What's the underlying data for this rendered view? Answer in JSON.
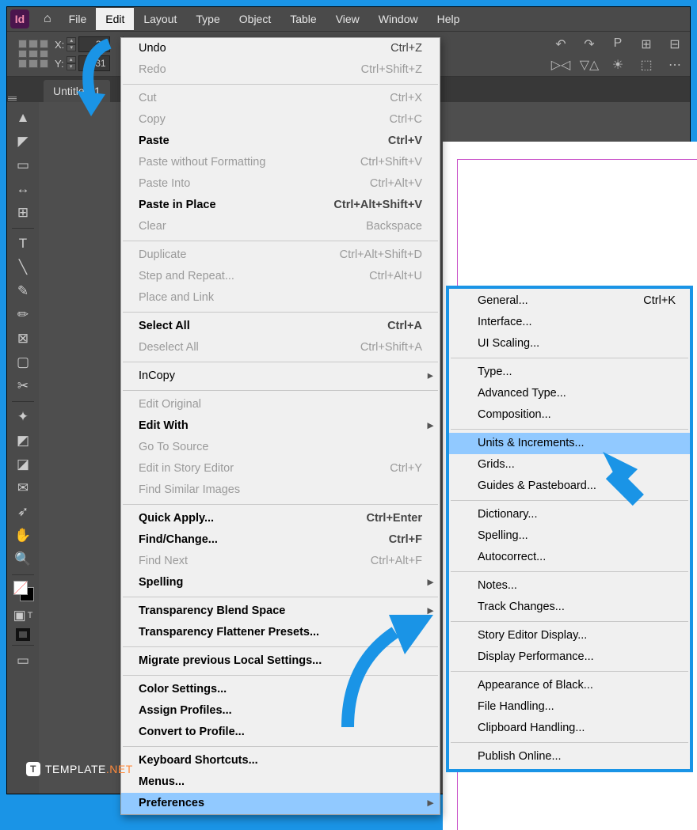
{
  "menubar": {
    "items": [
      "File",
      "Edit",
      "Layout",
      "Type",
      "Object",
      "Table",
      "View",
      "Window",
      "Help"
    ],
    "active": "Edit"
  },
  "control": {
    "x_val": "34",
    "y_val": "31"
  },
  "doc_tab": "Untitled-1",
  "edit_menu": [
    {
      "label": "Undo",
      "short": "Ctrl+Z"
    },
    {
      "label": "Redo",
      "short": "Ctrl+Shift+Z",
      "disabled": true
    },
    {
      "sep": true
    },
    {
      "label": "Cut",
      "short": "Ctrl+X",
      "disabled": true
    },
    {
      "label": "Copy",
      "short": "Ctrl+C",
      "disabled": true
    },
    {
      "label": "Paste",
      "short": "Ctrl+V",
      "bold": true
    },
    {
      "label": "Paste without Formatting",
      "short": "Ctrl+Shift+V",
      "disabled": true
    },
    {
      "label": "Paste Into",
      "short": "Ctrl+Alt+V",
      "disabled": true
    },
    {
      "label": "Paste in Place",
      "short": "Ctrl+Alt+Shift+V",
      "bold": true
    },
    {
      "label": "Clear",
      "short": "Backspace",
      "disabled": true
    },
    {
      "sep": true
    },
    {
      "label": "Duplicate",
      "short": "Ctrl+Alt+Shift+D",
      "disabled": true
    },
    {
      "label": "Step and Repeat...",
      "short": "Ctrl+Alt+U",
      "disabled": true
    },
    {
      "label": "Place and Link",
      "disabled": true
    },
    {
      "sep": true
    },
    {
      "label": "Select All",
      "short": "Ctrl+A",
      "bold": true
    },
    {
      "label": "Deselect All",
      "short": "Ctrl+Shift+A",
      "disabled": true
    },
    {
      "sep": true
    },
    {
      "label": "InCopy",
      "submenu": true
    },
    {
      "sep": true
    },
    {
      "label": "Edit Original",
      "disabled": true
    },
    {
      "label": "Edit With",
      "submenu": true,
      "bold": true
    },
    {
      "label": "Go To Source",
      "disabled": true
    },
    {
      "label": "Edit in Story Editor",
      "short": "Ctrl+Y",
      "disabled": true
    },
    {
      "label": "Find Similar Images",
      "disabled": true
    },
    {
      "sep": true
    },
    {
      "label": "Quick Apply...",
      "short": "Ctrl+Enter",
      "bold": true
    },
    {
      "label": "Find/Change...",
      "short": "Ctrl+F",
      "bold": true
    },
    {
      "label": "Find Next",
      "short": "Ctrl+Alt+F",
      "disabled": true
    },
    {
      "label": "Spelling",
      "submenu": true,
      "bold": true
    },
    {
      "sep": true
    },
    {
      "label": "Transparency Blend Space",
      "submenu": true,
      "bold": true
    },
    {
      "label": "Transparency Flattener Presets...",
      "bold": true
    },
    {
      "sep": true
    },
    {
      "label": "Migrate previous Local Settings...",
      "bold": true
    },
    {
      "sep": true
    },
    {
      "label": "Color Settings...",
      "bold": true
    },
    {
      "label": "Assign Profiles...",
      "bold": true
    },
    {
      "label": "Convert to Profile...",
      "bold": true
    },
    {
      "sep": true
    },
    {
      "label": "Keyboard Shortcuts...",
      "bold": true
    },
    {
      "label": "Menus...",
      "bold": true
    },
    {
      "label": "Preferences",
      "submenu": true,
      "highlight": true,
      "bold": true
    }
  ],
  "prefs_submenu": [
    {
      "label": "General...",
      "short": "Ctrl+K"
    },
    {
      "label": "Interface..."
    },
    {
      "label": "UI Scaling..."
    },
    {
      "sep": true
    },
    {
      "label": "Type..."
    },
    {
      "label": "Advanced Type..."
    },
    {
      "label": "Composition..."
    },
    {
      "sep": true
    },
    {
      "label": "Units & Increments...",
      "highlight": true
    },
    {
      "label": "Grids..."
    },
    {
      "label": "Guides & Pasteboard..."
    },
    {
      "sep": true
    },
    {
      "label": "Dictionary..."
    },
    {
      "label": "Spelling..."
    },
    {
      "label": "Autocorrect..."
    },
    {
      "sep": true
    },
    {
      "label": "Notes..."
    },
    {
      "label": "Track Changes..."
    },
    {
      "sep": true
    },
    {
      "label": "Story Editor Display..."
    },
    {
      "label": "Display Performance..."
    },
    {
      "sep": true
    },
    {
      "label": "Appearance of Black..."
    },
    {
      "label": "File Handling..."
    },
    {
      "label": "Clipboard Handling..."
    },
    {
      "sep": true
    },
    {
      "label": "Publish Online..."
    }
  ],
  "watermark": {
    "brand": "TEMPLATE",
    "suffix": ".NET"
  },
  "tools": [
    "select",
    "direct-select",
    "page",
    "gap",
    "content",
    "type",
    "line",
    "pen",
    "pencil",
    "rect",
    "rect-frame",
    "scissors",
    "free-transform",
    "gradient-swatch",
    "gradient-feather",
    "note",
    "eyedropper",
    "hand",
    "zoom"
  ]
}
